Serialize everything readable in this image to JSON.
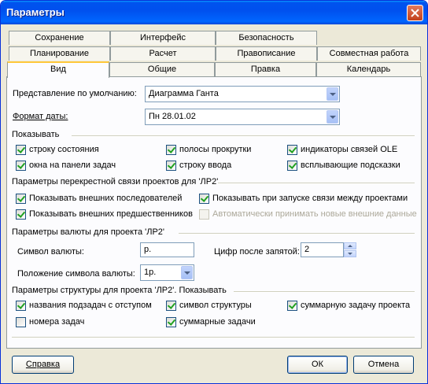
{
  "window": {
    "title": "Параметры"
  },
  "tabs": {
    "row1": [
      "Сохранение",
      "Интерфейс",
      "Безопасность"
    ],
    "row2": [
      "Планирование",
      "Расчет",
      "Правописание",
      "Совместная работа"
    ],
    "row3": [
      "Вид",
      "Общие",
      "Правка",
      "Календарь"
    ],
    "active": "Вид"
  },
  "view": {
    "default_view_label": "Представление по умолчанию:",
    "default_view_value": "Диаграмма Ганта",
    "date_format_label": "Формат даты:",
    "date_format_value": "Пн 28.01.02"
  },
  "show": {
    "title": "Показывать",
    "items": [
      {
        "label": "строку состояния",
        "checked": true
      },
      {
        "label": "полосы прокрутки",
        "checked": true
      },
      {
        "label": "индикаторы связей OLE",
        "checked": true
      },
      {
        "label": "окна на панели задач",
        "checked": true
      },
      {
        "label": "строку ввода",
        "checked": true
      },
      {
        "label": "всплывающие подсказки",
        "checked": true
      }
    ]
  },
  "crossproject": {
    "title": "Параметры перекрестной связи проектов для 'ЛР2'",
    "items": [
      {
        "label": "Показывать внешних последователей",
        "checked": true,
        "enabled": true
      },
      {
        "label": "Показывать при запуске связи между проектами",
        "checked": true,
        "enabled": true
      },
      {
        "label": "Показывать внешних предшественников",
        "checked": true,
        "enabled": true
      },
      {
        "label": "Автоматически принимать новые внешние данные",
        "checked": false,
        "enabled": false
      }
    ]
  },
  "currency": {
    "title": "Параметры валюты для проекта 'ЛР2'",
    "symbol_label": "Символ валюты:",
    "symbol_value": "р.",
    "decimals_label": "Цифр после запятой:",
    "decimals_value": "2",
    "placement_label": "Положение символа валюты:",
    "placement_value": "1р."
  },
  "outline": {
    "title": "Параметры структуры для проекта 'ЛР2'. Показывать",
    "items": [
      {
        "label": "названия подзадач с отступом",
        "checked": true
      },
      {
        "label": "символ структуры",
        "checked": true
      },
      {
        "label": "суммарную задачу проекта",
        "checked": true
      },
      {
        "label": "номера задач",
        "checked": false
      },
      {
        "label": "суммарные задачи",
        "checked": true
      }
    ]
  },
  "buttons": {
    "help": "Справка",
    "ok": "ОК",
    "cancel": "Отмена"
  },
  "icons": {
    "close": "close-icon",
    "dropdown": "chevron-down-icon",
    "spin_up": "spin-up-icon",
    "spin_down": "spin-down-icon"
  }
}
